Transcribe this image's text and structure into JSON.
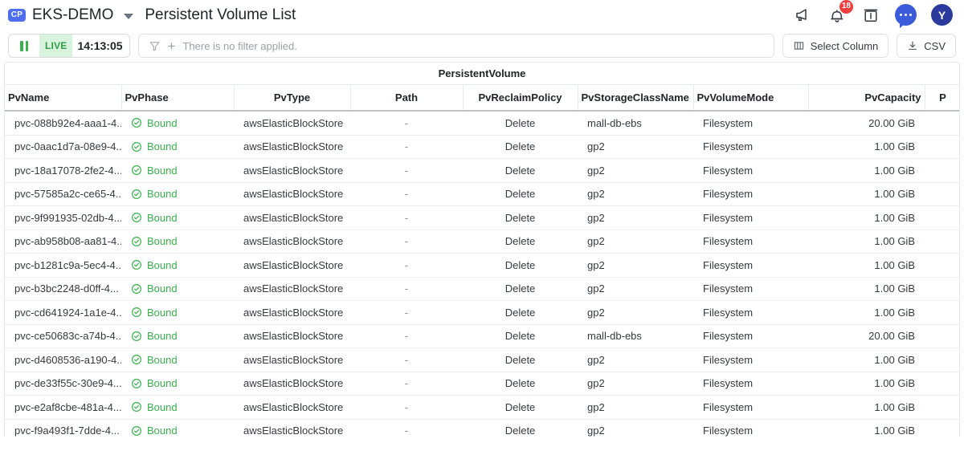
{
  "topbar": {
    "brand_badge": "CP",
    "brand_name": "EKS-DEMO",
    "page_title": "Persistent Volume List",
    "icons": [
      {
        "name": "megaphone-icon"
      },
      {
        "name": "bell-icon",
        "badge": "18"
      },
      {
        "name": "info-box-icon"
      },
      {
        "name": "chat-icon"
      },
      {
        "name": "avatar",
        "label": "Y"
      }
    ],
    "notification_count": "18",
    "avatar_letter": "Y",
    "colors": {
      "badge_blue": "#4e6ef2",
      "notification_red": "#f03e3e",
      "chat_blue": "#3b5bdb",
      "avatar_navy": "#2b3a9c"
    }
  },
  "toolbar": {
    "pause_label": "pause-icon",
    "live_label": "LIVE",
    "live_time": "14:13:05",
    "filter_placeholder": "There is no filter applied.",
    "select_column_label": "Select Column",
    "csv_label": "CSV",
    "colors": {
      "live_green": "#2f9e44",
      "live_bg": "#d7f3dd"
    }
  },
  "table": {
    "group_header": "PersistentVolume",
    "columns": [
      "PvName",
      "PvPhase",
      "PvType",
      "Path",
      "PvReclaimPolicy",
      "PvStorageClassName",
      "PvVolumeMode",
      "PvCapacity",
      "P"
    ],
    "rows": [
      {
        "name": "pvc-088b92e4-aaa1-4...",
        "phase": "Bound",
        "type": "awsElasticBlockStore",
        "path": "-",
        "reclaim": "Delete",
        "storage": "mall-db-ebs",
        "volmode": "Filesystem",
        "capacity": "20.00 GiB"
      },
      {
        "name": "pvc-0aac1d7a-08e9-4...",
        "phase": "Bound",
        "type": "awsElasticBlockStore",
        "path": "-",
        "reclaim": "Delete",
        "storage": "gp2",
        "volmode": "Filesystem",
        "capacity": "1.00 GiB"
      },
      {
        "name": "pvc-18a17078-2fe2-4...",
        "phase": "Bound",
        "type": "awsElasticBlockStore",
        "path": "-",
        "reclaim": "Delete",
        "storage": "gp2",
        "volmode": "Filesystem",
        "capacity": "1.00 GiB"
      },
      {
        "name": "pvc-57585a2c-ce65-4...",
        "phase": "Bound",
        "type": "awsElasticBlockStore",
        "path": "-",
        "reclaim": "Delete",
        "storage": "gp2",
        "volmode": "Filesystem",
        "capacity": "1.00 GiB"
      },
      {
        "name": "pvc-9f991935-02db-4...",
        "phase": "Bound",
        "type": "awsElasticBlockStore",
        "path": "-",
        "reclaim": "Delete",
        "storage": "gp2",
        "volmode": "Filesystem",
        "capacity": "1.00 GiB"
      },
      {
        "name": "pvc-ab958b08-aa81-4...",
        "phase": "Bound",
        "type": "awsElasticBlockStore",
        "path": "-",
        "reclaim": "Delete",
        "storage": "gp2",
        "volmode": "Filesystem",
        "capacity": "1.00 GiB"
      },
      {
        "name": "pvc-b1281c9a-5ec4-4...",
        "phase": "Bound",
        "type": "awsElasticBlockStore",
        "path": "-",
        "reclaim": "Delete",
        "storage": "gp2",
        "volmode": "Filesystem",
        "capacity": "1.00 GiB"
      },
      {
        "name": "pvc-b3bc2248-d0ff-4...",
        "phase": "Bound",
        "type": "awsElasticBlockStore",
        "path": "-",
        "reclaim": "Delete",
        "storage": "gp2",
        "volmode": "Filesystem",
        "capacity": "1.00 GiB"
      },
      {
        "name": "pvc-cd641924-1a1e-4...",
        "phase": "Bound",
        "type": "awsElasticBlockStore",
        "path": "-",
        "reclaim": "Delete",
        "storage": "gp2",
        "volmode": "Filesystem",
        "capacity": "1.00 GiB"
      },
      {
        "name": "pvc-ce50683c-a74b-4...",
        "phase": "Bound",
        "type": "awsElasticBlockStore",
        "path": "-",
        "reclaim": "Delete",
        "storage": "mall-db-ebs",
        "volmode": "Filesystem",
        "capacity": "20.00 GiB"
      },
      {
        "name": "pvc-d4608536-a190-4...",
        "phase": "Bound",
        "type": "awsElasticBlockStore",
        "path": "-",
        "reclaim": "Delete",
        "storage": "gp2",
        "volmode": "Filesystem",
        "capacity": "1.00 GiB"
      },
      {
        "name": "pvc-de33f55c-30e9-4...",
        "phase": "Bound",
        "type": "awsElasticBlockStore",
        "path": "-",
        "reclaim": "Delete",
        "storage": "gp2",
        "volmode": "Filesystem",
        "capacity": "1.00 GiB"
      },
      {
        "name": "pvc-e2af8cbe-481a-4...",
        "phase": "Bound",
        "type": "awsElasticBlockStore",
        "path": "-",
        "reclaim": "Delete",
        "storage": "gp2",
        "volmode": "Filesystem",
        "capacity": "1.00 GiB"
      },
      {
        "name": "pvc-f9a493f1-7dde-4...",
        "phase": "Bound",
        "type": "awsElasticBlockStore",
        "path": "-",
        "reclaim": "Delete",
        "storage": "gp2",
        "volmode": "Filesystem",
        "capacity": "1.00 GiB"
      }
    ]
  }
}
